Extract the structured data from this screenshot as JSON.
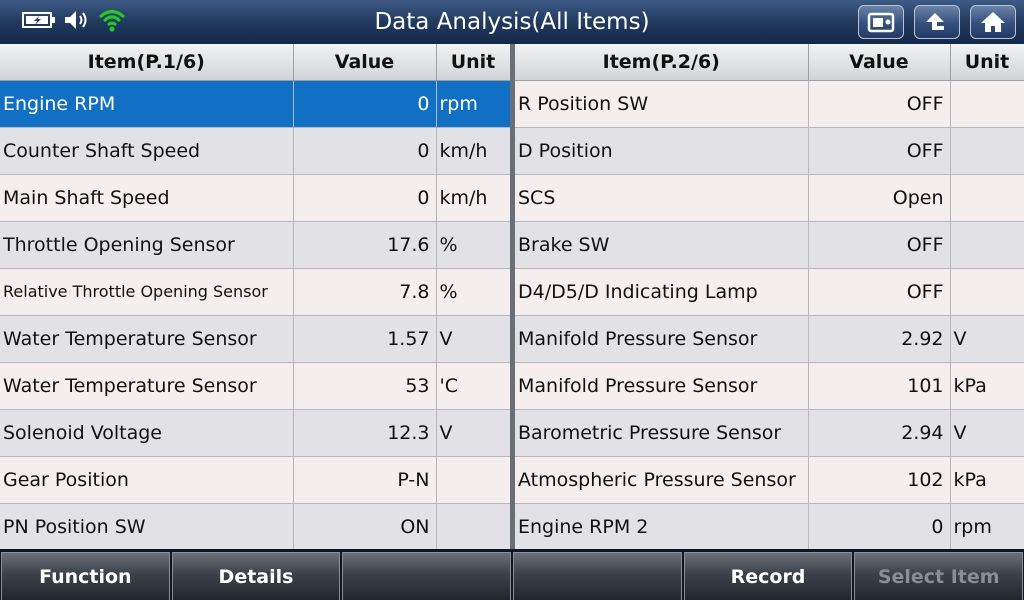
{
  "header": {
    "title": "Data Analysis(All Items)"
  },
  "colors": {
    "selected_row": "#1270c4",
    "wifi": "#22cc22"
  },
  "left_table": {
    "headers": {
      "item": "Item(P.1/6)",
      "value": "Value",
      "unit": "Unit"
    },
    "rows": [
      {
        "item": "Engine RPM",
        "value": "0",
        "unit": "rpm"
      },
      {
        "item": "Counter Shaft Speed",
        "value": "0",
        "unit": "km/h"
      },
      {
        "item": "Main Shaft Speed",
        "value": "0",
        "unit": "km/h"
      },
      {
        "item": "Throttle Opening Sensor",
        "value": "17.6",
        "unit": "%"
      },
      {
        "item": "Relative Throttle Opening Sensor",
        "value": "7.8",
        "unit": "%"
      },
      {
        "item": "Water Temperature Sensor",
        "value": "1.57",
        "unit": "V"
      },
      {
        "item": "Water Temperature Sensor",
        "value": "53",
        "unit": "'C"
      },
      {
        "item": "Solenoid Voltage",
        "value": "12.3",
        "unit": "V"
      },
      {
        "item": "Gear Position",
        "value": "P-N",
        "unit": ""
      },
      {
        "item": "PN Position SW",
        "value": "ON",
        "unit": ""
      }
    ]
  },
  "right_table": {
    "headers": {
      "item": "Item(P.2/6)",
      "value": "Value",
      "unit": "Unit"
    },
    "rows": [
      {
        "item": "R Position SW",
        "value": "OFF",
        "unit": ""
      },
      {
        "item": "D Position",
        "value": "OFF",
        "unit": ""
      },
      {
        "item": "SCS",
        "value": "Open",
        "unit": ""
      },
      {
        "item": "Brake SW",
        "value": "OFF",
        "unit": ""
      },
      {
        "item": "D4/D5/D Indicating Lamp",
        "value": "OFF",
        "unit": ""
      },
      {
        "item": "Manifold Pressure Sensor",
        "value": "2.92",
        "unit": "V"
      },
      {
        "item": "Manifold Pressure Sensor",
        "value": "101",
        "unit": "kPa"
      },
      {
        "item": "Barometric Pressure Sensor",
        "value": "2.94",
        "unit": "V"
      },
      {
        "item": "Atmospheric Pressure Sensor",
        "value": "102",
        "unit": "kPa"
      },
      {
        "item": "Engine RPM 2",
        "value": "0",
        "unit": "rpm"
      }
    ]
  },
  "footer": {
    "buttons": [
      {
        "label": "Function",
        "enabled": true
      },
      {
        "label": "Details",
        "enabled": true
      },
      {
        "label": "",
        "enabled": true
      },
      {
        "label": "",
        "enabled": true
      },
      {
        "label": "Record",
        "enabled": true
      },
      {
        "label": "Select Item",
        "enabled": false
      }
    ]
  },
  "icons": {
    "status": [
      "battery-icon",
      "volume-icon",
      "wifi-icon"
    ],
    "toolbar": [
      "screenshot-icon",
      "back-icon",
      "home-icon"
    ]
  }
}
